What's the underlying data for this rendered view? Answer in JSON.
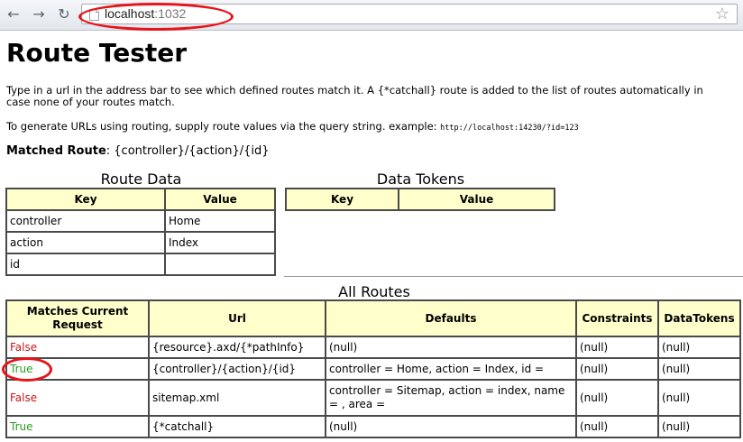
{
  "browser": {
    "nav": {
      "back_glyph": "←",
      "forward_glyph": "→",
      "reload_glyph": "↻"
    },
    "address": {
      "host": "localhost",
      "port": ":1032"
    },
    "star_glyph": "☆"
  },
  "page": {
    "title": "Route Tester",
    "intro": "Type in a url in the address bar to see which defined routes match it. A {*catchall} route is added to the list of routes automatically in case none of your routes match.",
    "generate_text": "To generate URLs using routing, supply route values via the query string. example: ",
    "example_url": "http://localhost:14230/?id=123",
    "matched_label": "Matched Route",
    "matched_value": ": {controller}/{action}/{id}"
  },
  "route_data": {
    "title": "Route Data",
    "headers": [
      "Key",
      "Value"
    ],
    "rows": [
      [
        "controller",
        "Home"
      ],
      [
        "action",
        "Index"
      ],
      [
        "id",
        ""
      ]
    ]
  },
  "data_tokens": {
    "title": "Data Tokens",
    "headers": [
      "Key",
      "Value"
    ]
  },
  "all_routes": {
    "title": "All Routes",
    "headers": [
      "Matches Current Request",
      "Url",
      "Defaults",
      "Constraints",
      "DataTokens"
    ],
    "rows": [
      {
        "match": "False",
        "url": "{resource}.axd/{*pathInfo}",
        "defaults": "(null)",
        "constraints": "(null)",
        "datatokens": "(null)"
      },
      {
        "match": "True",
        "url": "{controller}/{action}/{id}",
        "defaults": "controller = Home, action = Index, id =",
        "constraints": "(null)",
        "datatokens": "(null)"
      },
      {
        "match": "False",
        "url": "sitemap.xml",
        "defaults": "controller = Sitemap, action = index, name = , area =",
        "constraints": "(null)",
        "datatokens": "(null)"
      },
      {
        "match": "True",
        "url": "{*catchall}",
        "defaults": "(null)",
        "constraints": "(null)",
        "datatokens": "(null)"
      }
    ]
  },
  "colors": {
    "header_bg": "#ffffcc",
    "false_text": "#c0171b",
    "true_text": "#2a9d1e",
    "annotation_oval": "#e8141b"
  }
}
